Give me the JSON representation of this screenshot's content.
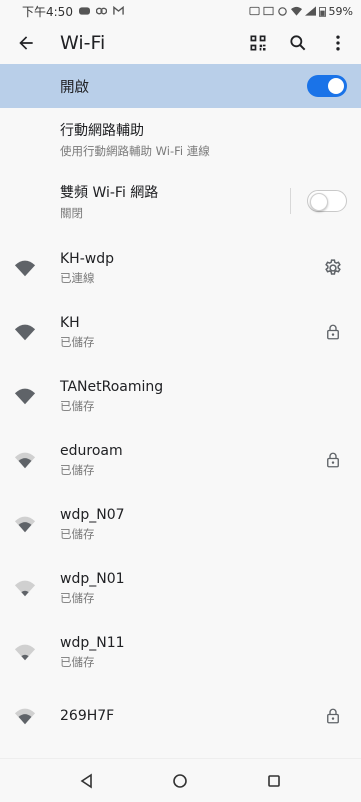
{
  "status_bar": {
    "time": "下午4:50",
    "battery": "59%"
  },
  "app_bar": {
    "title": "Wi-Fi"
  },
  "master_toggle": {
    "label": "開啟",
    "state": "on"
  },
  "options": [
    {
      "title": "行動網路輔助",
      "subtitle": "使用行動網路輔助 Wi-Fi 連線"
    },
    {
      "title": "雙頻 Wi-Fi 網路",
      "subtitle": "關閉",
      "state": "off"
    }
  ],
  "networks": [
    {
      "name": "KH-wdp",
      "status": "已連線",
      "signal": "full",
      "trail": "gear-icon"
    },
    {
      "name": "KH",
      "status": "已儲存",
      "signal": "full",
      "trail": "lock-icon"
    },
    {
      "name": "TANetRoaming",
      "status": "已儲存",
      "signal": "full",
      "trail": ""
    },
    {
      "name": "eduroam",
      "status": "已儲存",
      "signal": "medium",
      "trail": "lock-icon"
    },
    {
      "name": "wdp_N07",
      "status": "已儲存",
      "signal": "medium",
      "trail": ""
    },
    {
      "name": "wdp_N01",
      "status": "已儲存",
      "signal": "low",
      "trail": ""
    },
    {
      "name": "wdp_N11",
      "status": "已儲存",
      "signal": "low",
      "trail": ""
    },
    {
      "name": "269H7F",
      "status": "",
      "signal": "medium",
      "trail": "lock-icon"
    }
  ],
  "colors": {
    "accent": "#1a73e8",
    "highlight": "#b9cfe9"
  }
}
